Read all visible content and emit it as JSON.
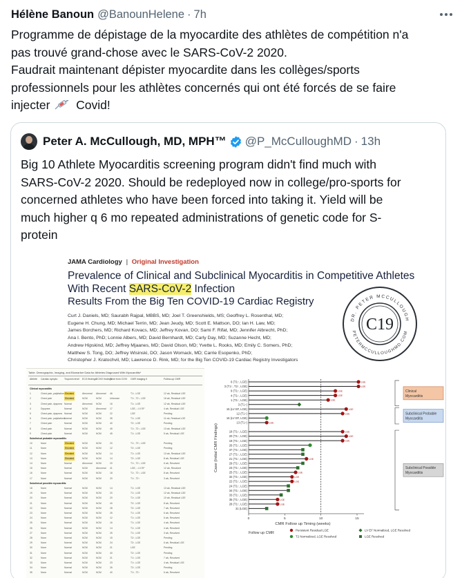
{
  "tweet": {
    "author_name": "Hélène Banoun",
    "handle": "@BanounHelene",
    "separator": "·",
    "time": "7h",
    "more_icon": "more-horizontal-icon",
    "lines": [
      "Programme de dépistage de la myocardite des athlètes de compétition n'a",
      "pas trouvé grand-chose avec le SARS-CoV-2 2020.",
      "Faudrait maintenant dépister myocardite dans les collèges/sports",
      "professionnels pour les athlètes concernés qui ont été forcés de se faire"
    ],
    "last_line_before": "injecter",
    "emoji_icon": "syringe-icon",
    "last_line_after": "Covid!"
  },
  "quote": {
    "author_name": "Peter A. McCullough, MD, MPH™",
    "verified_icon": "verified-badge-icon",
    "handle": "@P_McCulloughMD",
    "separator": "·",
    "time": "13h",
    "lines": [
      "Big 10 Athlete Myocarditis screening program didn't find much with",
      "SARS-CoV-2 2020.  Should be redeployed now in college/pro-sports for",
      "concerned athletes who have been forced into taking it.  Yield will be",
      "much higher q 6 mo repeated administrations of genetic code for S-",
      "protein"
    ]
  },
  "paper": {
    "journal": "JAMA Cardiology",
    "separator": "|",
    "investigation": "Original Investigation",
    "title_line1": "Prevalence of Clinical and Subclinical Myocarditis in Competitive Athletes",
    "title_line2_before": "With Recent ",
    "title_line2_highlight": "SARS-CoV-2",
    "title_line2_after": " Infection",
    "subtitle": "Results From the Big Ten COVID-19 Cardiac Registry",
    "authors": [
      "Curt J. Daniels, MD; Saurabh Rajpal, MBBS, MD; Joel T. Greenshields, MS; Geoffrey L. Rosenthal, MD;",
      "Eugene H. Chung, MD; Michael Terrin, MD; Jean Jeudy, MD; Scott E. Mattson, DO; Ian H. Law, MD;",
      "James Borchers, MD; Richard Kovacs, MD; Jeffrey Kovan, DO; Sami F. Rifat, MD; Jennifer Albrecht, PhD;",
      "Ana I. Bento, PhD; Lonnie Albers, MD; David Bernhardt, MD; Carly Day, MD; Suzanne Hecht, MD;",
      "Andrew Hipskind, MD; Jeffrey Mjaanes, MD; David Olson, MD; Yvette L. Rooks, MD; Emily C. Somers, PhD;",
      "Matthew S. Tong, DO; Jeffrey Wisinski, DO; Jason Womack, MD; Carrie Esopenko, PhD;",
      "Christopher J. Kratochvil, MD; Lawrence D. Rink, MD; for the Big Ten COVID-19 Cardiac Registry Investigators"
    ],
    "seal": {
      "center_text": "C19",
      "top_arc": "DR. PETER MCCULLOUGH",
      "bottom_arc": "PETERMCCULLOUGHMD.COM"
    }
  },
  "table": {
    "caption": "Table. Demographic, Imaging, and Biomarker Data for Athletes Diagnosed With Myocarditis*",
    "headers": [
      "Athlete",
      "Cardiac symptoms",
      "Troponin level",
      "ECG findings",
      "ECHO findings",
      "Time from COVID-19 diagnosis, d",
      "CMR imaging findings",
      "Follow-up CMR imaging results"
    ],
    "rows": [
      {
        "section": "Clinical myocarditis"
      },
      {
        "cells": [
          "1",
          "Chest pain, palpitations",
          "Elevated",
          "Abnormal",
          "Abnormal",
          "46",
          "T1↑, LGE",
          "12 wk, Residual LGE"
        ],
        "flag": true
      },
      {
        "cells": [
          "2",
          "Chest pain",
          "Elevated",
          "NCM",
          "NCM",
          "Unknown",
          "T1↑, T2↑, LGE",
          "16 wk, Residual LGE"
        ],
        "flag": true
      },
      {
        "cells": [
          "3",
          "Chest pain, dyspnea",
          "Normal",
          "Abnormal",
          "NCM",
          "16",
          "T1↑, LGE",
          "12 wk, Residual LGE"
        ]
      },
      {
        "cells": [
          "4",
          "Dyspnea",
          "Normal",
          "NCM",
          "Abnormal",
          "17",
          "LGE, ↓ LV EF",
          "4 wk, Residual LGE"
        ]
      },
      {
        "cells": [
          "5",
          "Chest pain, dyspnea",
          "Normal",
          "NCM",
          "NCM",
          "22",
          "LGE",
          "Pending"
        ]
      },
      {
        "cells": [
          "6",
          "Chest pain, palpitations",
          "Normal",
          "NCM",
          "NCM",
          "35",
          "T1↑, LGE",
          "11 wk, Residual LGE"
        ]
      },
      {
        "cells": [
          "7",
          "Chest pain",
          "Normal",
          "NCM",
          "NCM",
          "40",
          "T2↑, LGE",
          "Pending"
        ]
      },
      {
        "cells": [
          "8",
          "Chest pain",
          "Normal",
          "NCM",
          "NCM",
          "45",
          "T1↑, T2↑, LGE",
          "13 wk, Residual LGE"
        ]
      },
      {
        "cells": [
          "9",
          "Chest pain",
          "Normal",
          "NCM",
          "NCM",
          "45",
          "T1↑, LGE",
          "5 wk, Residual LGE"
        ]
      },
      {
        "section": "Subclinical probable myocarditis"
      },
      {
        "cells": [
          "10",
          "None",
          "Elevated",
          "NCM",
          "NCM",
          "20",
          "T1↑, T2↑, LGE",
          "Pending"
        ],
        "flag": true
      },
      {
        "cells": [
          "11",
          "None",
          "Elevated",
          "NCM",
          "NCM",
          "12",
          "T2↑, LGE",
          "Pending"
        ],
        "flag": true
      },
      {
        "cells": [
          "12",
          "None",
          "Elevated",
          "NCM",
          "NCM",
          "14",
          "T1↑, LGE",
          "13 wk, Residual LGE"
        ],
        "flag": true
      },
      {
        "cells": [
          "13",
          "None",
          "Elevated",
          "NCM",
          "NCM",
          "14",
          "T2↑, LGE",
          "8 wk, Residual LGE"
        ],
        "flag": true
      },
      {
        "cells": [
          "14",
          "None",
          "Normal",
          "Abnormal",
          "NCM",
          "20",
          "T1↑, T2↑, LGE",
          "6 wk, Resolved"
        ]
      },
      {
        "cells": [
          "15",
          "None",
          "Normal",
          "NCM",
          "Abnormal",
          "41",
          "LGE, ↓ LV EF",
          "12 wk, Resolved"
        ]
      },
      {
        "cells": [
          "16",
          "None",
          "Normal",
          "NCM",
          "NCM",
          "18",
          "T1↑, T2↑, LGE",
          "8 wk, Resolved"
        ]
      },
      {
        "cells": [
          "17",
          "None",
          "Normal",
          "NCM",
          "NCM",
          "20",
          "T1↑, T2↑",
          "3 wk, Resolved"
        ]
      },
      {
        "section": "Subclinical possible myocarditis"
      },
      {
        "cells": [
          "18",
          "None",
          "Normal",
          "NCM",
          "NCM",
          "14",
          "T1↑, LGE",
          "13 wk, Residual LGE"
        ]
      },
      {
        "cells": [
          "19",
          "None",
          "Normal",
          "NCM",
          "NCM",
          "20",
          "T1↑, LGE",
          "12 wk, Residual LGE"
        ]
      },
      {
        "cells": [
          "20",
          "None",
          "Normal",
          "NCM",
          "NCM",
          "20",
          "T1↑, LGE",
          "10 wk, Residual LGE"
        ]
      },
      {
        "cells": [
          "21",
          "None",
          "Normal",
          "NCM",
          "NCM",
          "40",
          "T2↑, LGE",
          "8 wk, Resolved"
        ]
      },
      {
        "cells": [
          "22",
          "None",
          "Normal",
          "NCM",
          "NCM",
          "28",
          "T2↑, LGE",
          "7 wk, Resolved"
        ]
      },
      {
        "cells": [
          "23",
          "None",
          "Normal",
          "NCM",
          "NCM",
          "25",
          "T1↑, LGE",
          "6 wk, Resolved"
        ]
      },
      {
        "cells": [
          "24",
          "None",
          "Normal",
          "NCM",
          "NCM",
          "12",
          "T1↑, LGE",
          "6 wk, Resolved"
        ]
      },
      {
        "cells": [
          "25",
          "None",
          "Normal",
          "NCM",
          "NCM",
          "16",
          "T1↑, LGE",
          "4 wk, Resolved"
        ]
      },
      {
        "cells": [
          "26",
          "None",
          "Normal",
          "NCM",
          "NCM",
          "14",
          "T1↑, LGE",
          "4 wk, Resolved"
        ]
      },
      {
        "cells": [
          "27",
          "None",
          "Normal",
          "NCM",
          "NCM",
          "25",
          "T1↑, LGE",
          "3 wk, Resolved"
        ]
      },
      {
        "cells": [
          "28",
          "None",
          "Normal",
          "NCM",
          "NCM",
          "15",
          "T2↑, LGE",
          "Pending"
        ]
      },
      {
        "cells": [
          "29",
          "None",
          "Normal",
          "NCM",
          "NCM",
          "24",
          "T2↑, LGE",
          "6 wk, Residual LGE"
        ]
      },
      {
        "cells": [
          "30",
          "None",
          "Normal",
          "NCM",
          "NCM",
          "21",
          "LGE",
          "Pending"
        ]
      },
      {
        "cells": [
          "31",
          "None",
          "Normal",
          "NCM",
          "NCM",
          "40",
          "T2↑, LGE",
          "Pending"
        ]
      },
      {
        "cells": [
          "32",
          "None",
          "Normal",
          "NCM",
          "NCM",
          "21",
          "T1↑, LGE",
          "7 wk, Resolved"
        ]
      },
      {
        "cells": [
          "33",
          "None",
          "Normal",
          "NCM",
          "NCM",
          "23",
          "T1↑, LGE",
          "4 wk, Residual LGE"
        ]
      },
      {
        "cells": [
          "34",
          "None",
          "Normal",
          "NCM",
          "NCM",
          "26",
          "T2↑, LGE",
          "Pending"
        ]
      },
      {
        "cells": [
          "35",
          "None",
          "Normal",
          "NCM",
          "NCM",
          "40",
          "T1↑, T2↑",
          "6 wk, Resolved"
        ]
      }
    ]
  },
  "chart_data": {
    "type": "scatter",
    "ylabel": "Case (Initial CMR Findings)",
    "xlabel": "CMR Follow up Timing (weeks)",
    "x_ticks": [
      "0",
      "5",
      "10",
      "15"
    ],
    "xlim": [
      0,
      15
    ],
    "vline_x": 10,
    "legend_title": "Follow up CMR",
    "legend_items": [
      {
        "label": "Persistent Residual LGE",
        "marker": "circle",
        "color": "#a01515"
      },
      {
        "label": "LV EF Normalized, LGE Resolved",
        "marker": "diamond",
        "color": "#2e6e2e"
      },
      {
        "label": "T2 Normalized, LGE Resolved",
        "marker": "circle",
        "color": "#2e8b2e"
      },
      {
        "label": "LGE Resolved",
        "marker": "square",
        "color": "#2e6e2e"
      }
    ],
    "groups": [
      {
        "label": "Clinical Myocarditis",
        "fill": "#f4c6a6",
        "stroke": "#c8794a",
        "from": 0,
        "to": 5
      },
      {
        "label": "Subclinical Probable Myocarditis",
        "fill": "#c9d9ef",
        "stroke": "#6d8cc4",
        "from": 6,
        "to": 9
      },
      {
        "label": "Subclinical Possible Myocarditis",
        "fill": "#d6d6d6",
        "stroke": "#8a8a8a",
        "from": 11,
        "to": 28
      }
    ],
    "cases": [
      {
        "label": "6 (T1↑, LGE)",
        "x": 15.2,
        "status": "residual",
        "tag": "LGE"
      },
      {
        "label": "3 (T1↑, T2↑, LGE)",
        "x": 15.2,
        "status": "residual",
        "tag": "LGE"
      },
      {
        "label": "9 (T1↑, LGE)",
        "x": 12.0,
        "status": "residual",
        "tag": "LGE"
      },
      {
        "label": "4 (T1↑, LGE)",
        "x": 12.0,
        "status": "residual",
        "tag": "LGE"
      },
      {
        "label": "1 (T1↑, LGE)",
        "x": 11.0,
        "status": "residual",
        "tag": "LGE"
      },
      {
        "label": "3 (T1↑)",
        "x": 7.0,
        "status": "lvef"
      },
      {
        "label": "15 (LV EF, LGE)",
        "x": 13.5,
        "status": "residual",
        "tag": "LGE"
      },
      {
        "label": "12 (T1↑)",
        "x": 13.0,
        "status": "residual",
        "tag": "LGE"
      },
      {
        "label": "16 (LV EF, LGE)",
        "x": 2.5,
        "status": "t2norm"
      },
      {
        "label": "13 (T1↑)",
        "x": 2.5,
        "status": "residual",
        "tag": "LGE"
      },
      {
        "label": "",
        "x": null,
        "status": "none"
      },
      {
        "label": "18 (T1↑, LGE)",
        "x": 13.0,
        "status": "residual",
        "tag": "LGE"
      },
      {
        "label": "20 (T1↑, LGE)",
        "x": 13.5,
        "status": "residual",
        "tag": "LGE"
      },
      {
        "label": "19 (T1↑, LGE)",
        "x": 13.0,
        "status": "residual",
        "tag": "LGE"
      },
      {
        "label": "26 (T1↑, LGE)",
        "x": 8.5,
        "status": "t2norm"
      },
      {
        "label": "37 (T1↑, LGE)",
        "x": 7.5,
        "status": "lgeres"
      },
      {
        "label": "27 (T1↑, LGE)",
        "x": 7.5,
        "status": "lgeres"
      },
      {
        "label": "21 (T1↑, LGE)",
        "x": 8.0,
        "status": "residual",
        "tag": "LGE"
      },
      {
        "label": "29 (T1↑, LGE)",
        "x": 7.5,
        "status": "lgeres"
      },
      {
        "label": "23 (T1↑, LGE)",
        "x": 6.8,
        "status": "lgeres"
      },
      {
        "label": "25 (T1↑, LGE)",
        "x": 6.5,
        "status": "residual",
        "tag": "LGE"
      },
      {
        "label": "32 (T1↑, LGE)",
        "x": 6.0,
        "status": "residual",
        "tag": "LGE"
      },
      {
        "label": "22 (T1↑, LGE)",
        "x": 6.0,
        "status": "residual",
        "tag": "LGE"
      },
      {
        "label": "24 (T1↑, LGE)",
        "x": 5.5,
        "status": "lgeres"
      },
      {
        "label": "34 (T1↑, LGE)",
        "x": 5.5,
        "status": "lgeres"
      },
      {
        "label": "33 (T1↑, LGE)",
        "x": 4.5,
        "status": "lgeres"
      },
      {
        "label": "35 (T1↑, LGE)",
        "x": 4.0,
        "status": "residual",
        "tag": "LGE"
      },
      {
        "label": "28 (T1↑, LGE)",
        "x": 4.0,
        "status": "residual",
        "tag": "LGE"
      },
      {
        "label": "31 (LGE)",
        "x": 2.5,
        "status": "lgeres"
      }
    ]
  },
  "colors": {
    "text_primary": "#0f1419",
    "text_secondary": "#536471",
    "verified_blue": "#1d9bf0",
    "border": "#cfd9de",
    "highlight": "#f6ee6b"
  }
}
